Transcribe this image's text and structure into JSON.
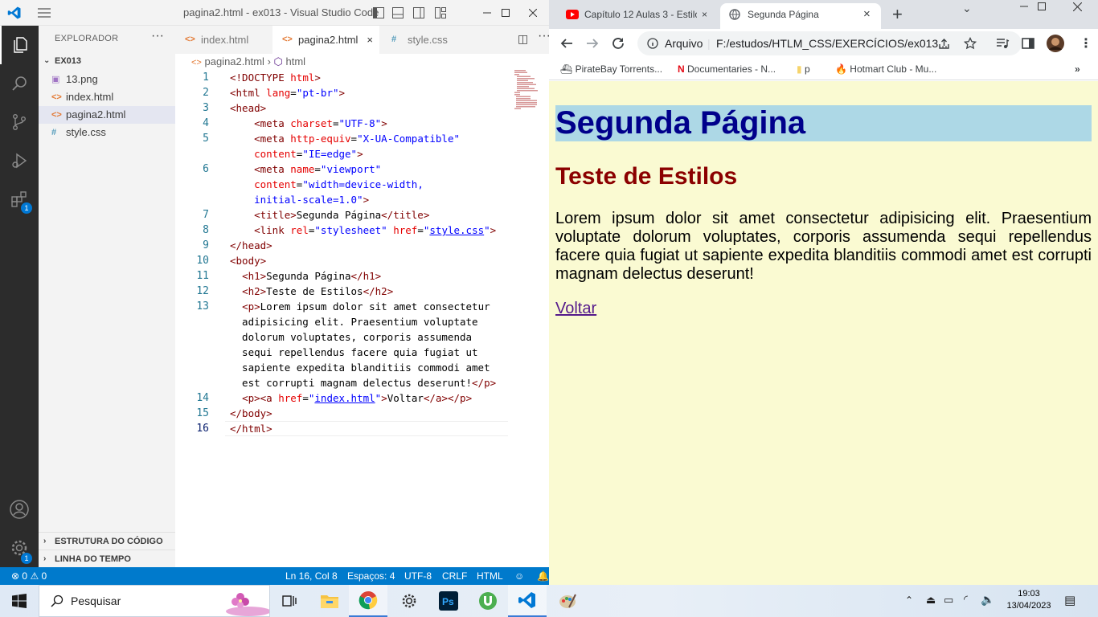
{
  "vscode": {
    "window_title": "pagina2.html - ex013 - Visual Studio Code",
    "explorer_title": "EXPLORADOR",
    "folder": "EX013",
    "files": [
      {
        "name": "13.png",
        "icon": "image-file-icon",
        "color": "#a074c4"
      },
      {
        "name": "index.html",
        "icon": "html-file-icon",
        "color": "#e37933"
      },
      {
        "name": "pagina2.html",
        "icon": "html-file-icon",
        "color": "#e37933",
        "selected": true
      },
      {
        "name": "style.css",
        "icon": "css-file-icon",
        "color": "#519aba"
      }
    ],
    "sections": [
      "ESTRUTURA DO CÓDIGO",
      "LINHA DO TEMPO"
    ],
    "tabs": [
      {
        "label": "index.html",
        "icon": "<>"
      },
      {
        "label": "pagina2.html",
        "icon": "<>",
        "active": true,
        "close": "×"
      },
      {
        "label": "style.css",
        "icon": "#"
      }
    ],
    "breadcrumb": [
      "pagina2.html",
      "html"
    ],
    "badges": {
      "extensions": "1",
      "settings": "1"
    },
    "line_numbers": [
      "1",
      "2",
      "3",
      "4",
      "5",
      "",
      "6",
      "",
      "",
      "7",
      "8",
      "9",
      "10",
      "11",
      "12",
      "13",
      "",
      "",
      "",
      "",
      "",
      "14",
      "15",
      "16"
    ],
    "status": {
      "errors": "0",
      "warnings": "0",
      "position": "Ln 16, Col 8",
      "spaces": "Espaços: 4",
      "encoding": "UTF-8",
      "eol": "CRLF",
      "language": "HTML"
    }
  },
  "chrome": {
    "tabs": [
      {
        "label": "Capítulo 12 Aulas 3 - Estilo",
        "favicon": "youtube-icon"
      },
      {
        "label": "Segunda Página",
        "favicon": "globe-icon",
        "active": true
      }
    ],
    "new_tab": "+",
    "address_prefix": "Arquivo",
    "address": "F:/estudos/HTLM_CSS/EXERCÍCIOS/ex013...",
    "bookmarks": [
      {
        "label": "PirateBay Torrents...",
        "icon": "pirate-ship-icon"
      },
      {
        "label": "Documentaries - N...",
        "icon": "netflix-icon"
      },
      {
        "label": "p",
        "icon": "folder-icon"
      },
      {
        "label": "Hotmart Club - Mu...",
        "icon": "hotmart-icon"
      }
    ],
    "page": {
      "h1": "Segunda Página",
      "h2": "Teste de Estilos",
      "paragraph": "Lorem ipsum dolor sit amet consectetur adipisicing elit. Praesentium voluptate dolorum voluptates, corporis assumenda sequi repellendus facere quia fugiat ut sapiente expedita blanditiis commodi amet est corrupti magnam delectus deserunt!",
      "link": "Voltar"
    }
  },
  "taskbar": {
    "search_placeholder": "Pesquisar",
    "time": "19:03",
    "date": "13/04/2023"
  }
}
